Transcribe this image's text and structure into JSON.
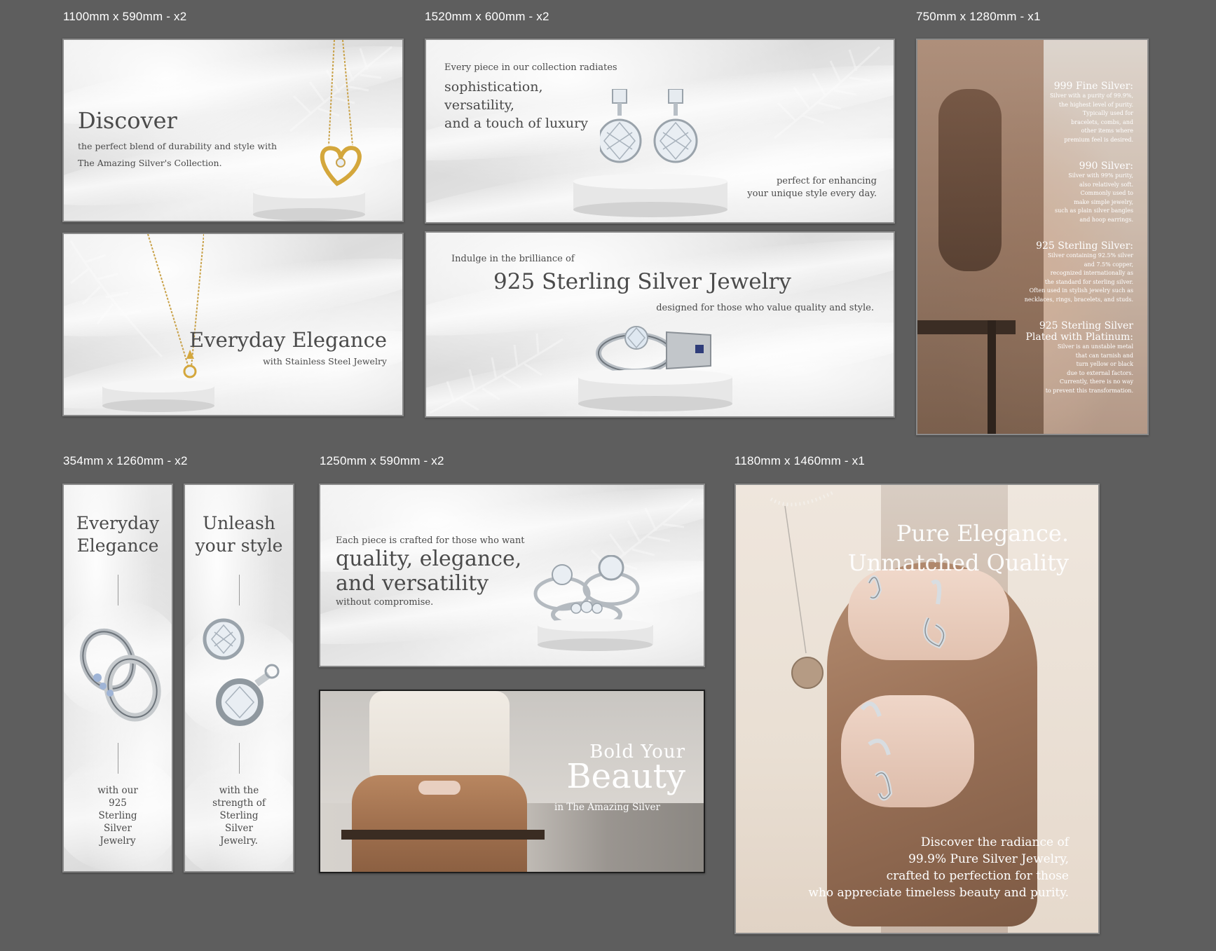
{
  "labels": {
    "a": "1100mm x 590mm - x2",
    "b": "1520mm x 600mm - x2",
    "c": "750mm x 1280mm - x1",
    "d": "354mm x 1260mm - x2",
    "e": "1250mm x 590mm - x2",
    "f": "1180mm x 1460mm - x1"
  },
  "p1": {
    "title": "Discover",
    "line1": "the perfect blend of durability and style with",
    "line2": "The Amazing Silver's Collection."
  },
  "p2": {
    "title": "Everyday Elegance",
    "sub": "with Stainless Steel Jewelry"
  },
  "p3": {
    "intro": "Every piece in our collection radiates",
    "l1": "sophistication,",
    "l2": "versatility,",
    "l3": "and a touch of luxury",
    "r1": "perfect for enhancing",
    "r2": "your unique style every day."
  },
  "p4": {
    "intro": "Indulge in the brilliance of",
    "title": "925 Sterling Silver Jewelry",
    "sub": "designed for those who value quality and style."
  },
  "p5": {
    "s1_title": "999 Fine Silver:",
    "s1_lines": [
      "Silver with a purity of 99.9%,",
      "the highest level of purity.",
      "Typically used for",
      "bracelets, combs, and",
      "other items where",
      "premium feel is desired."
    ],
    "s2_title": "990 Silver:",
    "s2_lines": [
      "Silver with 99% purity,",
      "also relatively soft.",
      "Commonly used to",
      "make simple jewelry,",
      "such as plain silver bangles",
      "and hoop earrings."
    ],
    "s3_title": "925 Sterling Silver:",
    "s3_lines": [
      "Silver containing 92.5% silver",
      "and 7.5% copper,",
      "recognized internationally as",
      "the standard for sterling silver.",
      "Often used in stylish jewelry such as",
      "necklaces, rings, bracelets, and studs."
    ],
    "s4_title1": "925 Sterling Silver",
    "s4_title2": "Plated with Platinum:",
    "s4_lines": [
      "Silver is an unstable metal",
      "that can tarnish and",
      "turn yellow or black",
      "due to external factors.",
      "Currently, there is no way",
      "to prevent this transformation."
    ]
  },
  "p6": {
    "t1": "Everyday",
    "t2": "Elegance",
    "b1": "with our",
    "b2": "925",
    "b3": "Sterling",
    "b4": "Silver",
    "b5": "Jewelry"
  },
  "p7": {
    "t1": "Unleash",
    "t2": "your style",
    "b1": "with the",
    "b2": "strength of",
    "b3": "Sterling",
    "b4": "Silver",
    "b5": "Jewelry."
  },
  "p8": {
    "intro": "Each piece is crafted for those who want",
    "l1": "quality, elegance,",
    "l2": "and versatility",
    "l3": "without compromise."
  },
  "p9": {
    "l1": "Bold Your",
    "l2": "Beauty",
    "l3": "in The Amazing Silver"
  },
  "p10": {
    "t1": "Pure Elegance.",
    "t2": "Unmatched Quality",
    "b1": "Discover the radiance of",
    "b2": "99.9% Pure Silver Jewelry,",
    "b3": "crafted to perfection for those",
    "b4": "who appreciate timeless beauty and purity."
  }
}
